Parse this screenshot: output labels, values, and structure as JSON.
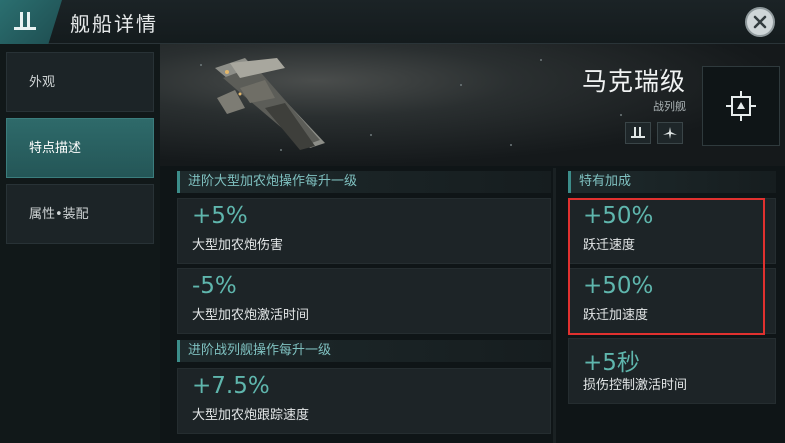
{
  "header": {
    "title": "舰船详情"
  },
  "sidebar": {
    "items": [
      {
        "label": "外观",
        "active": false
      },
      {
        "label": "特点描述",
        "active": true
      },
      {
        "label": "属性•装配",
        "active": false
      }
    ]
  },
  "ship": {
    "name": "马克瑞级",
    "class": "战列舰",
    "icons": [
      "battleship-class-icon",
      "aircraft-icon"
    ],
    "slot_icon": "module-slot-icon"
  },
  "sections": {
    "large_cannon": {
      "title": "进阶大型加农炮操作每升一级",
      "stats": [
        {
          "value": "+5%",
          "label": "大型加农炮伤害"
        },
        {
          "value": "-5%",
          "label": "大型加农炮激活时间"
        }
      ]
    },
    "battleship": {
      "title": "进阶战列舰操作每升一级",
      "stats": [
        {
          "value": "+7.5%",
          "label": "大型加农炮跟踪速度"
        }
      ]
    },
    "special": {
      "title": "特有加成",
      "stats": [
        {
          "value": "+50%",
          "label": "跃迁速度"
        },
        {
          "value": "+50%",
          "label": "跃迁加速度"
        },
        {
          "value": "+5秒",
          "label": "损伤控制激活时间"
        }
      ]
    }
  },
  "colors": {
    "accent": "#3c8d8a",
    "value_text": "#5fb6ad",
    "highlight": "#e0312f",
    "active_tab": "#2e6a6a"
  }
}
